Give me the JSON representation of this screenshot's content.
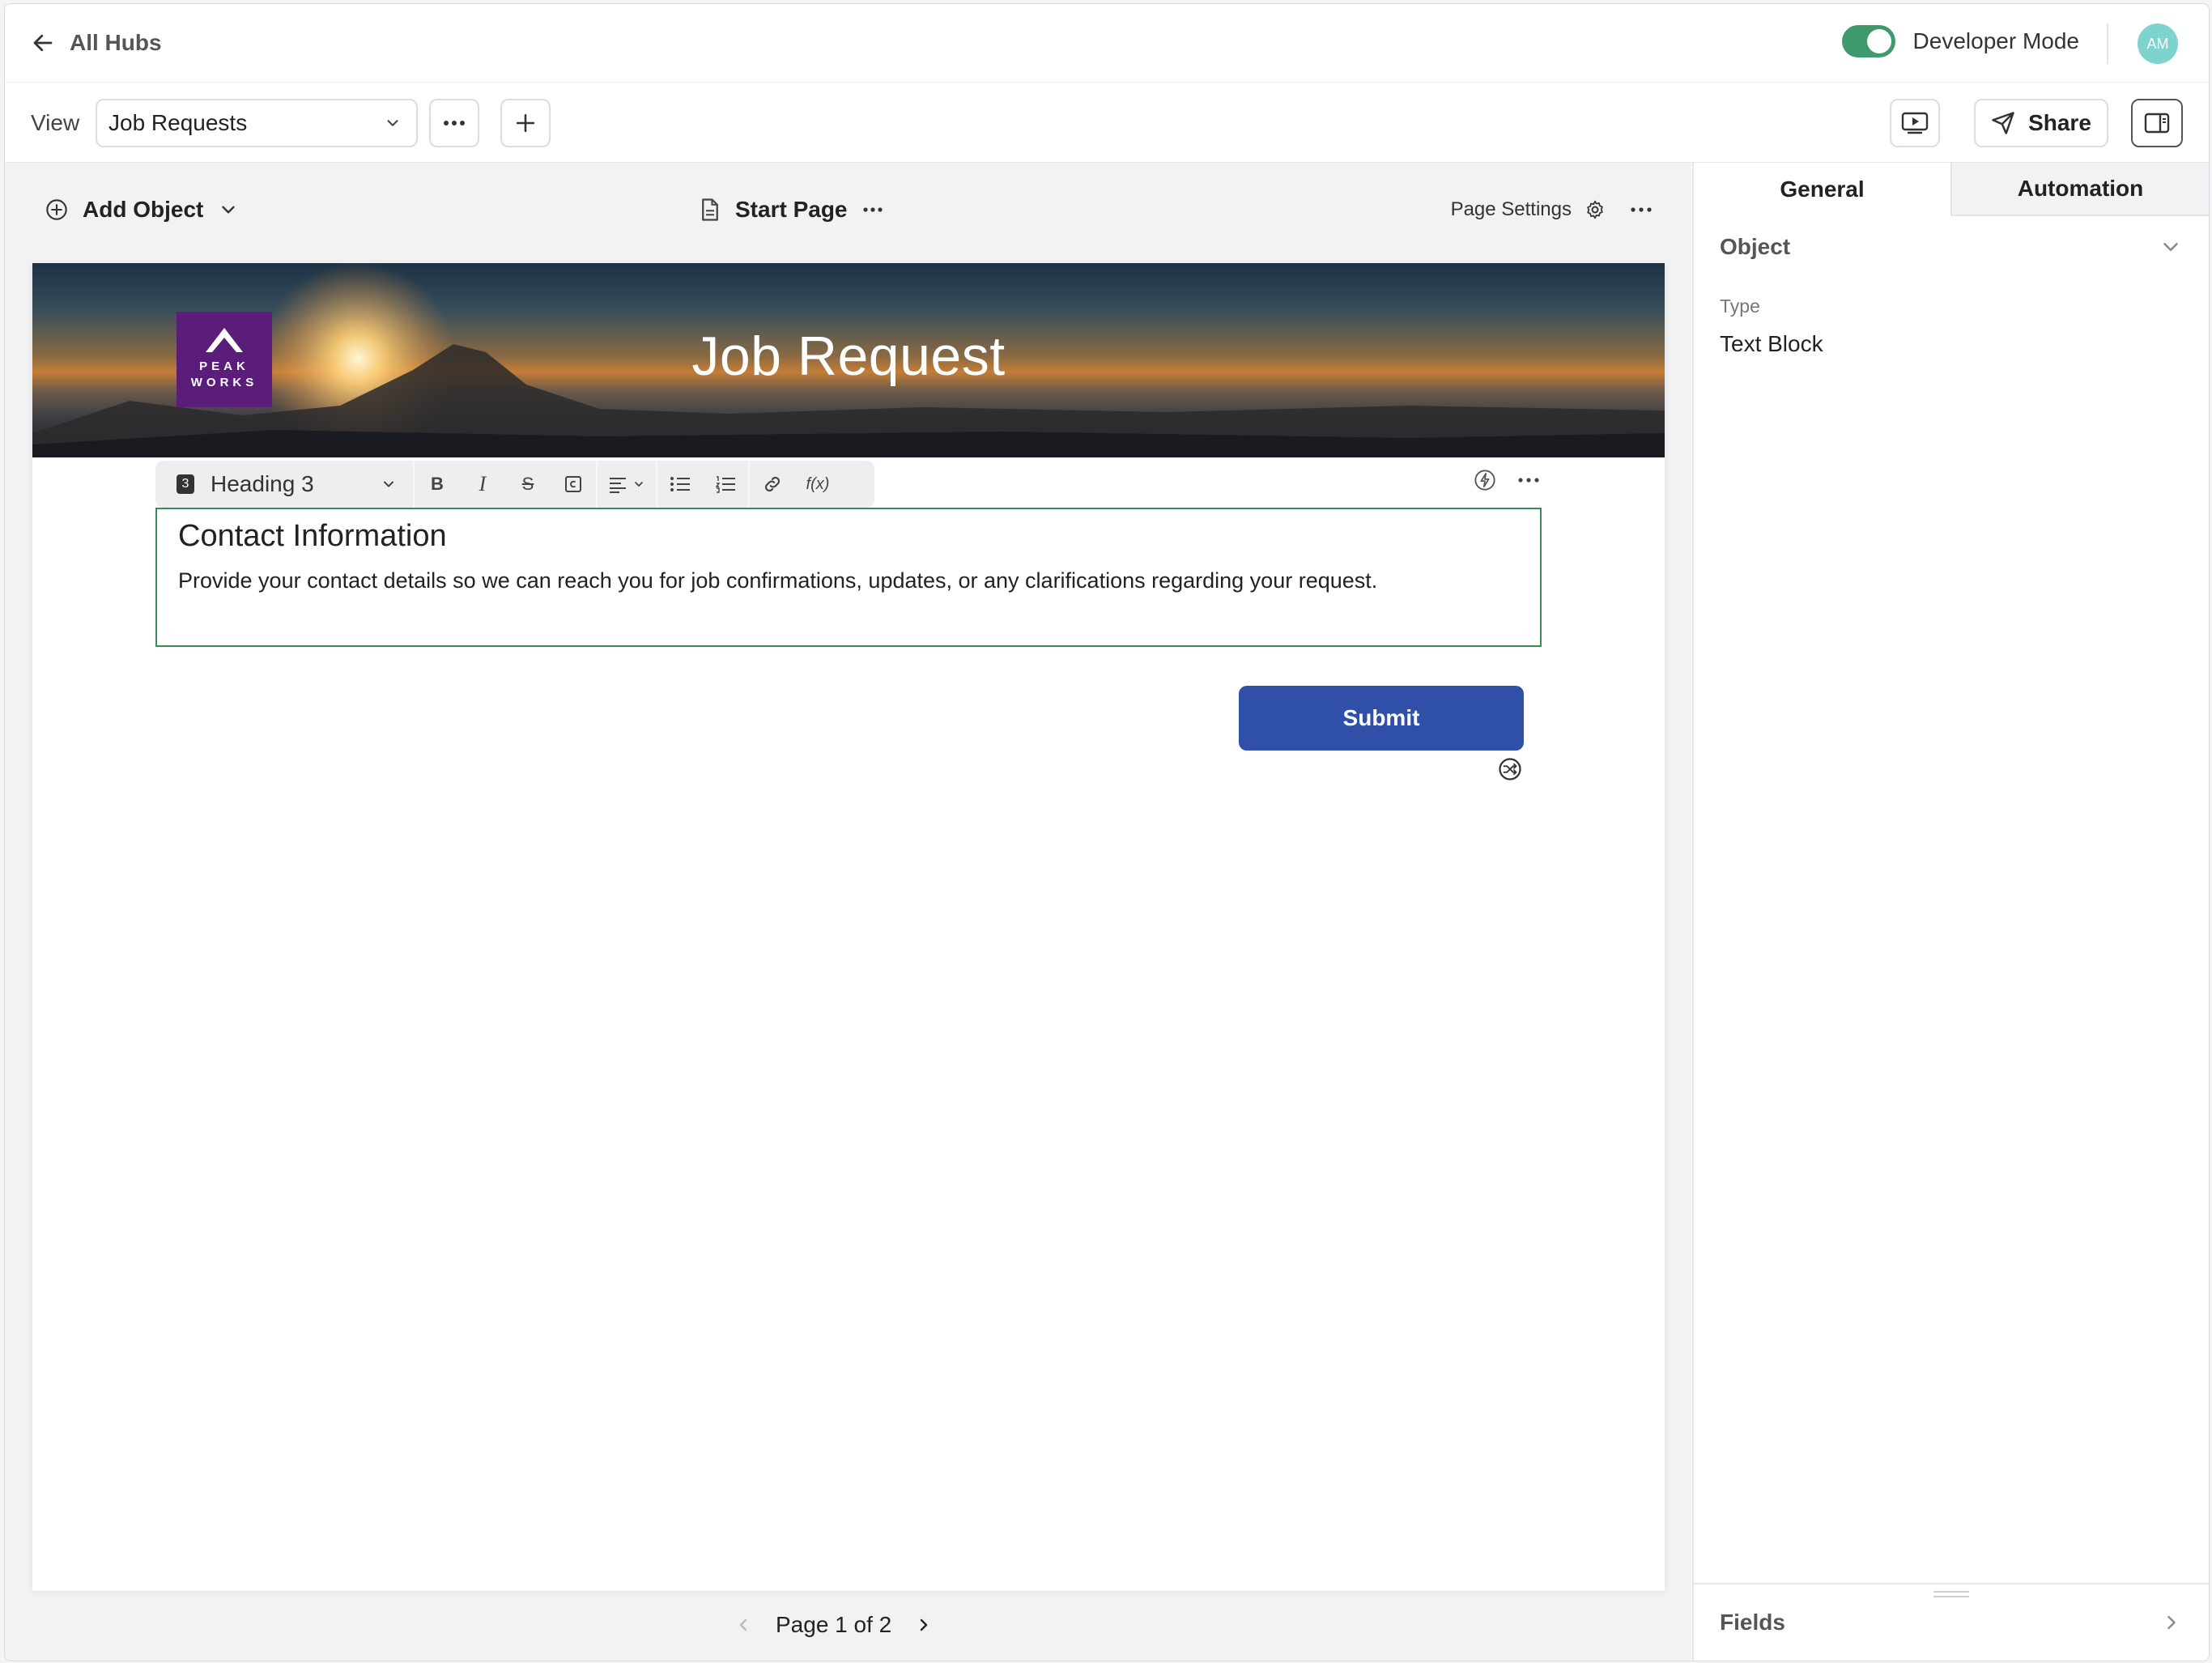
{
  "header": {
    "back_label": "All Hubs",
    "developer_mode_label": "Developer Mode",
    "developer_mode_on": true,
    "avatar_initials": "AM"
  },
  "viewbar": {
    "view_label": "View",
    "selected_view": "Job Requests",
    "share_label": "Share"
  },
  "canvas": {
    "add_object_label": "Add Object",
    "page_name": "Start Page",
    "page_settings_label": "Page Settings"
  },
  "banner": {
    "title": "Job Request",
    "logo_line1": "PEAK",
    "logo_line2": "WORKS"
  },
  "format_toolbar": {
    "heading_number": "3",
    "heading_label": "Heading 3",
    "function_label": "f(x)"
  },
  "text_block": {
    "heading": "Contact Information",
    "body": "Provide your contact details so we can reach you for job confirmations, updates, or any clarifications regarding your request."
  },
  "form": {
    "submit_label": "Submit"
  },
  "pager": {
    "label": "Page 1 of 2"
  },
  "panel": {
    "tabs": [
      {
        "label": "General"
      },
      {
        "label": "Automation"
      }
    ],
    "object_label": "Object",
    "type_label": "Type",
    "type_value": "Text Block",
    "fields_label": "Fields"
  },
  "colors": {
    "toggle_on": "#3e9a6a",
    "submit_bg": "#2f4fa8",
    "selection_border": "#3a8b5c",
    "logo_bg": "#5a1e7a",
    "avatar_bg": "#7ed3cf"
  }
}
